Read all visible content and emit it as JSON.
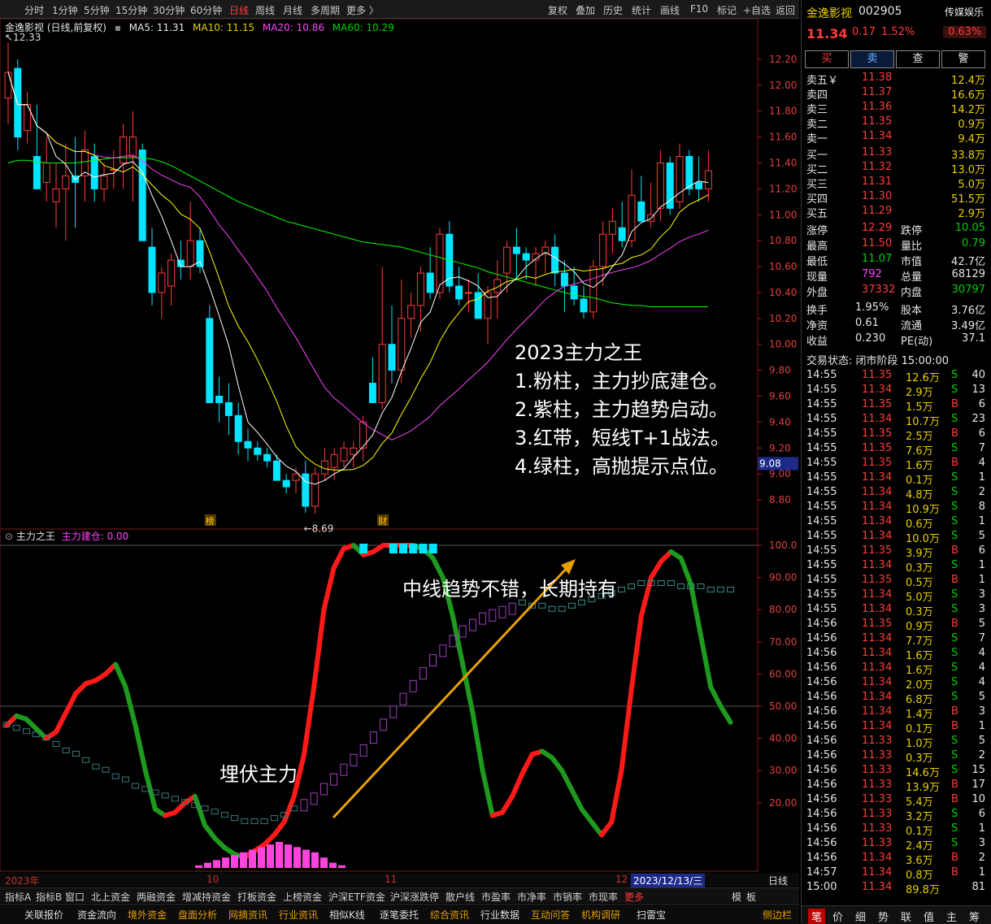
{
  "toolbar": {
    "periods": [
      "分时",
      "1分钟",
      "5分钟",
      "15分钟",
      "30分钟",
      "60分钟",
      "日线",
      "周线",
      "月线",
      "多周期",
      "更多 〉"
    ],
    "active_period": "日线",
    "actions": [
      "复权",
      "叠加",
      "历史",
      "统计",
      "画线",
      "F10",
      "标记",
      "+自选",
      "返回"
    ]
  },
  "legend": {
    "title": "金逸影视 (日线,前复权)",
    "ma5": "MA5: 11.31",
    "ma10": "MA10: 11.15",
    "ma20": "MA20: 10.86",
    "ma60": "MA60: 10.29"
  },
  "indicator": {
    "name": "主力之王",
    "value_label": "主力建仓: 0.00"
  },
  "chart_data": {
    "type": "candlestick",
    "price_ylim": [
      8.7,
      12.3
    ],
    "price_ticks": [
      "12.20",
      "12.00",
      "11.80",
      "11.60",
      "11.40",
      "11.20",
      "11.00",
      "10.80",
      "10.60",
      "10.40",
      "10.20",
      "10.00",
      "9.80",
      "9.60",
      "9.40",
      "9.20",
      "9.00",
      "8.80"
    ],
    "indicator_ticks": [
      "100.0",
      "90.00",
      "80.00",
      "70.00",
      "60.00",
      "50.00",
      "40.00",
      "30.00",
      "20.00"
    ],
    "current_price_tag": "9.08",
    "high_label": "12.33",
    "low_label": "8.69",
    "badge_labels": [
      "榜",
      "财"
    ],
    "x_labels": [
      {
        "text": "2023年",
        "i": 0
      },
      {
        "text": "10",
        "i": 20
      },
      {
        "text": "11",
        "i": 38
      },
      {
        "text": "12",
        "i": 58
      }
    ],
    "date_highlight": "2023/12/13/三",
    "colors": {
      "up": "#ff3b3b",
      "down": "#00e5ff",
      "ma5": "#ffffff",
      "ma10": "#ffff00",
      "ma20": "#ff44ff",
      "ma60": "#00ff00"
    },
    "candles": [
      [
        11.9,
        12.33,
        11.7,
        12.1
      ],
      [
        12.13,
        12.2,
        11.5,
        11.6
      ],
      [
        11.65,
        11.95,
        11.55,
        11.85
      ],
      [
        11.45,
        11.85,
        11.2,
        11.2
      ],
      [
        11.25,
        11.6,
        11.1,
        11.4
      ],
      [
        11.1,
        11.4,
        10.9,
        11.2
      ],
      [
        11.2,
        11.55,
        10.8,
        11.3
      ],
      [
        11.3,
        11.6,
        10.9,
        11.25
      ],
      [
        11.3,
        11.65,
        11.1,
        11.5
      ],
      [
        11.45,
        11.55,
        11.1,
        11.2
      ],
      [
        11.2,
        11.4,
        11.1,
        11.3
      ],
      [
        11.35,
        11.5,
        11.2,
        11.35
      ],
      [
        11.4,
        11.7,
        11.2,
        11.6
      ],
      [
        11.45,
        11.8,
        11.1,
        11.6
      ],
      [
        11.5,
        11.55,
        10.8,
        10.8
      ],
      [
        10.75,
        10.9,
        10.3,
        10.4
      ],
      [
        10.4,
        10.6,
        10.2,
        10.55
      ],
      [
        10.45,
        10.7,
        10.3,
        10.65
      ],
      [
        10.65,
        10.8,
        10.5,
        10.6
      ],
      [
        10.6,
        11.1,
        10.5,
        10.8
      ],
      [
        10.8,
        10.9,
        10.55,
        10.6
      ],
      [
        10.2,
        10.3,
        9.55,
        9.55
      ],
      [
        9.6,
        9.75,
        9.4,
        9.55
      ],
      [
        9.55,
        9.7,
        9.3,
        9.45
      ],
      [
        9.45,
        9.55,
        9.15,
        9.25
      ],
      [
        9.25,
        9.35,
        9.1,
        9.2
      ],
      [
        9.2,
        9.25,
        9.1,
        9.15
      ],
      [
        9.15,
        9.2,
        9.05,
        9.1
      ],
      [
        9.1,
        9.15,
        8.95,
        8.95
      ],
      [
        8.95,
        9.0,
        8.85,
        8.9
      ],
      [
        8.95,
        9.05,
        8.85,
        9.0
      ],
      [
        9.0,
        9.1,
        8.7,
        8.75
      ],
      [
        8.75,
        9.05,
        8.69,
        9.0
      ],
      [
        9.0,
        9.2,
        8.95,
        9.1
      ],
      [
        9.05,
        9.2,
        8.95,
        9.15
      ],
      [
        9.1,
        9.25,
        9.05,
        9.2
      ],
      [
        9.15,
        9.25,
        9.05,
        9.2
      ],
      [
        9.2,
        9.45,
        9.1,
        9.4
      ],
      [
        9.7,
        9.9,
        9.55,
        9.55
      ],
      [
        9.55,
        10.6,
        9.5,
        10.0
      ],
      [
        10.0,
        10.3,
        9.7,
        9.8
      ],
      [
        9.8,
        10.5,
        9.7,
        10.2
      ],
      [
        10.2,
        10.4,
        10.05,
        10.3
      ],
      [
        10.3,
        10.6,
        10.1,
        10.55
      ],
      [
        10.55,
        10.75,
        10.35,
        10.4
      ],
      [
        10.4,
        10.9,
        10.35,
        10.85
      ],
      [
        10.85,
        10.95,
        10.4,
        10.45
      ],
      [
        10.45,
        10.6,
        10.3,
        10.35
      ],
      [
        10.4,
        10.5,
        10.25,
        10.4
      ],
      [
        10.4,
        10.55,
        10.2,
        10.2
      ],
      [
        10.2,
        10.45,
        10.0,
        10.4
      ],
      [
        10.4,
        10.65,
        10.2,
        10.5
      ],
      [
        10.55,
        10.8,
        10.4,
        10.75
      ],
      [
        10.75,
        10.9,
        10.5,
        10.7
      ],
      [
        10.7,
        10.75,
        10.5,
        10.65
      ],
      [
        10.65,
        10.75,
        10.45,
        10.7
      ],
      [
        10.7,
        10.8,
        10.55,
        10.75
      ],
      [
        10.75,
        10.85,
        10.45,
        10.55
      ],
      [
        10.55,
        10.65,
        10.25,
        10.45
      ],
      [
        10.45,
        10.6,
        10.3,
        10.35
      ],
      [
        10.35,
        10.45,
        10.2,
        10.25
      ],
      [
        10.25,
        10.65,
        10.2,
        10.6
      ],
      [
        10.6,
        10.95,
        10.45,
        10.85
      ],
      [
        10.85,
        11.05,
        10.7,
        10.95
      ],
      [
        10.9,
        11.1,
        10.75,
        10.8
      ],
      [
        10.8,
        11.35,
        10.75,
        11.15
      ],
      [
        11.1,
        11.3,
        11.0,
        10.95
      ],
      [
        10.95,
        11.25,
        10.9,
        11.0
      ],
      [
        11.05,
        11.5,
        10.95,
        11.4
      ],
      [
        11.4,
        11.45,
        11.0,
        11.05
      ],
      [
        11.1,
        11.55,
        11.05,
        11.45
      ],
      [
        11.45,
        11.5,
        11.15,
        11.2
      ],
      [
        11.25,
        11.45,
        11.1,
        11.2
      ],
      [
        11.2,
        11.5,
        11.1,
        11.34
      ]
    ],
    "ma60": [
      11.4,
      11.42,
      11.42,
      11.41,
      11.4,
      11.4,
      11.4,
      11.4,
      11.41,
      11.42,
      11.43,
      11.44,
      11.44,
      11.44,
      11.44,
      11.43,
      11.41,
      11.38,
      11.34,
      11.3,
      11.26,
      11.22,
      11.18,
      11.14,
      11.1,
      11.07,
      11.04,
      11.01,
      10.98,
      10.95,
      10.93,
      10.91,
      10.89,
      10.87,
      10.85,
      10.83,
      10.81,
      10.79,
      10.78,
      10.77,
      10.76,
      10.75,
      10.73,
      10.71,
      10.69,
      10.67,
      10.65,
      10.63,
      10.61,
      10.59,
      10.56,
      10.54,
      10.52,
      10.5,
      10.48,
      10.46,
      10.44,
      10.42,
      10.4,
      10.38,
      10.37,
      10.36,
      10.34,
      10.32,
      10.31,
      10.3,
      10.3,
      10.29,
      10.29,
      10.29,
      10.29,
      10.29,
      10.29,
      10.29
    ],
    "indicator": {
      "bar_values": [
        0,
        0,
        0,
        0,
        0,
        0,
        0,
        0,
        0,
        0,
        0,
        0,
        0,
        0,
        0,
        0,
        0,
        0,
        0,
        0,
        0,
        0,
        0,
        1,
        2,
        3,
        4,
        5,
        6,
        7,
        8,
        9,
        10,
        9,
        8,
        7,
        6,
        4,
        2,
        1
      ],
      "note": "主力建仓 pink bars shown near bottom"
    }
  },
  "annotations": {
    "title": "2023主力之王",
    "line1": "1.粉柱，主力抄底建仓。",
    "line2": "2.紫柱，主力趋势启动。",
    "line3": "3.红带，短线T+1战法。",
    "line4": "4.绿柱，高抛提示点位。",
    "arrow_text": "中线趋势不错，长期持有",
    "ambush_text": "埋伏主力"
  },
  "bottom_tabs": [
    "指标A",
    "指标B",
    "窗口",
    "北上资金",
    "两融资金",
    "增减持资金",
    "打板资金",
    "上榜资金",
    "沪深ETF资金",
    "沪深涨跌停",
    "散户线",
    "市盈率",
    "市净率",
    "市销率",
    "市现率",
    "更多"
  ],
  "bottom_right": [
    "模",
    "板"
  ],
  "bottom_links": [
    "关联报价",
    "资金流向",
    "境外资金",
    "盘面分析",
    "网摘资讯",
    "行业资讯",
    "相似K线",
    "逐笔委托",
    "综合资讯",
    "行业数据",
    "互动问答",
    "机构调研",
    "扫雷宝"
  ],
  "side_label": "侧边栏",
  "period_label": "日线",
  "stock": {
    "name": "金逸影视",
    "code": "002905",
    "sector": "传媒娱乐",
    "sector_change": "0.63%",
    "price": "11.34",
    "change": "0.17",
    "change_pct": "1.52%",
    "buttons": [
      "买",
      "卖",
      "查",
      "警"
    ]
  },
  "asks": [
    {
      "label": "卖五￥",
      "price": "11.38",
      "vol": "12.4万"
    },
    {
      "label": "卖四",
      "price": "11.37",
      "vol": "16.6万"
    },
    {
      "label": "卖三",
      "price": "11.36",
      "vol": "14.2万"
    },
    {
      "label": "卖二",
      "price": "11.35",
      "vol": "0.9万"
    },
    {
      "label": "卖一",
      "price": "11.34",
      "vol": "9.4万"
    }
  ],
  "bids": [
    {
      "label": "买一",
      "price": "11.33",
      "vol": "33.8万"
    },
    {
      "label": "买二",
      "price": "11.32",
      "vol": "13.0万"
    },
    {
      "label": "买三",
      "price": "11.31",
      "vol": "5.0万"
    },
    {
      "label": "买四",
      "price": "11.30",
      "vol": "51.5万"
    },
    {
      "label": "买五",
      "price": "11.29",
      "vol": "2.9万"
    }
  ],
  "stats": [
    {
      "k1": "涨停",
      "v1": "12.29",
      "c1": "red",
      "k2": "跌停",
      "v2": "10.05",
      "c2": "green"
    },
    {
      "k1": "最高",
      "v1": "11.50",
      "c1": "red",
      "k2": "量比",
      "v2": "0.79",
      "c2": "green"
    },
    {
      "k1": "最低",
      "v1": "11.07",
      "c1": "green",
      "k2": "市值",
      "v2": "42.7亿",
      "c2": "white"
    },
    {
      "k1": "现量",
      "v1": "792",
      "c1": "magenta",
      "k2": "总量",
      "v2": "68129",
      "c2": "white"
    },
    {
      "k1": "外盘",
      "v1": "37332",
      "c1": "red",
      "k2": "内盘",
      "v2": "30797",
      "c2": "green"
    }
  ],
  "stats2": [
    {
      "k1": "换手",
      "v1": "1.95%",
      "k2": "股本",
      "v2": "3.76亿"
    },
    {
      "k1": "净资",
      "v1": "0.61",
      "k2": "流通",
      "v2": "3.49亿"
    },
    {
      "k1": "收益",
      "v1": "0.230",
      "k2": "PE(动)",
      "v2": "37.1"
    }
  ],
  "trade_status": "交易状态: 闭市阶段 15:00:00",
  "ticks": [
    [
      "14:55",
      "11.35",
      "12.6万",
      "S",
      "40"
    ],
    [
      "14:55",
      "11.34",
      "2.9万",
      "S",
      "13"
    ],
    [
      "14:55",
      "11.35",
      "1.5万",
      "B",
      "6"
    ],
    [
      "14:55",
      "11.34",
      "10.7万",
      "S",
      "23"
    ],
    [
      "14:55",
      "11.35",
      "2.5万",
      "B",
      "6"
    ],
    [
      "14:55",
      "11.35",
      "7.6万",
      "S",
      "7"
    ],
    [
      "14:55",
      "11.35",
      "1.6万",
      "B",
      "4"
    ],
    [
      "14:55",
      "11.34",
      "0.1万",
      "S",
      "1"
    ],
    [
      "14:55",
      "11.34",
      "4.8万",
      "S",
      "2"
    ],
    [
      "14:55",
      "11.34",
      "10.9万",
      "S",
      "8"
    ],
    [
      "14:55",
      "11.34",
      "0.6万",
      "S",
      "1"
    ],
    [
      "14:55",
      "11.34",
      "10.0万",
      "S",
      "5"
    ],
    [
      "14:55",
      "11.35",
      "3.9万",
      "B",
      "6"
    ],
    [
      "14:55",
      "11.34",
      "0.3万",
      "S",
      "1"
    ],
    [
      "14:55",
      "11.35",
      "0.5万",
      "B",
      "1"
    ],
    [
      "14:55",
      "11.34",
      "5.0万",
      "S",
      "3"
    ],
    [
      "14:55",
      "11.34",
      "0.3万",
      "S",
      "3"
    ],
    [
      "14:56",
      "11.35",
      "0.9万",
      "B",
      "5"
    ],
    [
      "14:56",
      "11.34",
      "7.7万",
      "S",
      "7"
    ],
    [
      "14:56",
      "11.34",
      "1.6万",
      "S",
      "4"
    ],
    [
      "14:56",
      "11.34",
      "1.6万",
      "S",
      "4"
    ],
    [
      "14:56",
      "11.34",
      "2.0万",
      "S",
      "4"
    ],
    [
      "14:56",
      "11.34",
      "6.8万",
      "S",
      "5"
    ],
    [
      "14:56",
      "11.34",
      "1.4万",
      "B",
      "3"
    ],
    [
      "14:56",
      "11.34",
      "0.1万",
      "B",
      "1"
    ],
    [
      "14:56",
      "11.33",
      "1.0万",
      "S",
      "5"
    ],
    [
      "14:56",
      "11.33",
      "0.3万",
      "S",
      "2"
    ],
    [
      "14:56",
      "11.33",
      "14.6万",
      "S",
      "15"
    ],
    [
      "14:56",
      "11.33",
      "13.9万",
      "B",
      "17"
    ],
    [
      "14:56",
      "11.33",
      "5.4万",
      "B",
      "10"
    ],
    [
      "14:56",
      "11.33",
      "3.2万",
      "S",
      "6"
    ],
    [
      "14:56",
      "11.33",
      "0.1万",
      "S",
      "1"
    ],
    [
      "14:56",
      "11.33",
      "2.4万",
      "S",
      "3"
    ],
    [
      "14:56",
      "11.34",
      "3.6万",
      "B",
      "2"
    ],
    [
      "14:57",
      "11.34",
      "0.8万",
      "B",
      "1"
    ],
    [
      "15:00",
      "11.34",
      "89.8万",
      "",
      "81"
    ]
  ],
  "right_tabs": [
    "笔",
    "价",
    "细",
    "势",
    "联",
    "值",
    "主",
    "筹"
  ]
}
